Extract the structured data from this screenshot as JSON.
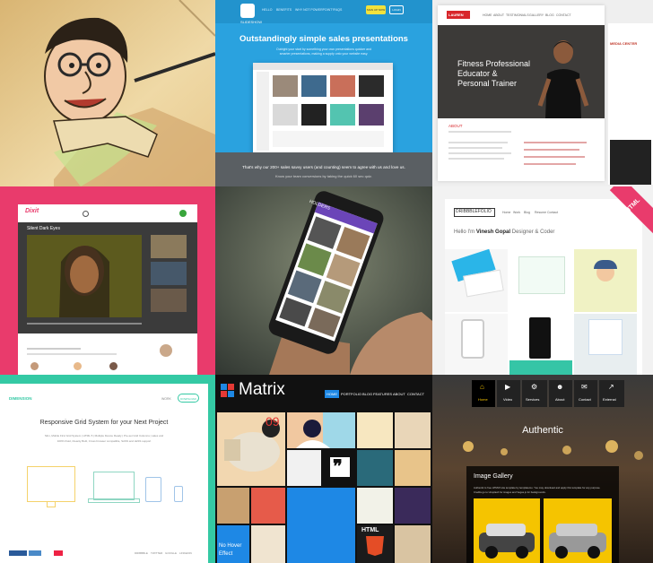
{
  "tile2": {
    "nav": [
      "HELLO",
      "BENEFITS",
      "WHY NOT POWERPOINT?",
      "FAQS"
    ],
    "cta": "SIGN UP NOW",
    "login": "LOGIN",
    "brand": "SLIDESHOW",
    "headline": "Outstandingly simple sales presentations",
    "sub1": "Outright your start by something your own presentations quicker and",
    "sub2": "smarter presentations, making a supply onto your website easy.",
    "bottom": "That's why our 200+ sales savvy users (and counting) seem to agree with us and love us.",
    "bottom2": "Know your team conversions by taking the quick 60 sec quiz."
  },
  "tile3": {
    "logo": "LAUREN",
    "nav": [
      "HOME",
      "ABOUT",
      "TESTIMONIALS",
      "GALLERY",
      "BLOG",
      "CONTACT"
    ],
    "hero": [
      "Fitness Professional",
      "Educator &",
      "Personal Trainer"
    ],
    "about": "ABOUT",
    "sideLogo": "MEDIA CENTER"
  },
  "tile4": {
    "logo": "Dixit",
    "title": "Silent Dark Eyes"
  },
  "tile5": {
    "app": "HOLDERS"
  },
  "tile6": {
    "logo": "DRIBBBLEFOLIO",
    "nav": [
      "Home",
      "Work",
      "Blog",
      "Resume",
      "Contact"
    ],
    "hello": "Hello I'm ",
    "name": "Vinesh Gopal",
    "role": " Designer & Coder",
    "ribbon": "HTML"
  },
  "tile7": {
    "logo": "DIMENSION",
    "nav": [
      "WORK"
    ],
    "cta": "DOWNLOAD",
    "title": "Responsive Grid System for your Next Project",
    "desc": [
      "Slim, Mobile First Grid System | HTML 5 | Multiple Device Ready | Pre-set Grid Columns | sales and",
      "100% Fluid, Cleanly Built, Cross browser compatible, SASS and LESS support"
    ],
    "footer": [
      "DRIBBBLE",
      "TWITTER",
      "GOOGLE",
      "LINKEDIN"
    ]
  },
  "tile8": {
    "brand": "Matrix",
    "nav": [
      "HOME",
      "PORTFOLIO",
      "BLOG",
      "FEATURES",
      "ABOUT",
      "CONTACT"
    ],
    "hover": [
      "No Hover",
      "Effect"
    ],
    "html": "HTML",
    "nine": "09"
  },
  "tile9": {
    "nav": [
      "Home",
      "Video",
      "Services",
      "About",
      "Contact",
      "External"
    ],
    "hero": "Authentic",
    "galleryTitle": "Image Gallery",
    "galleryText1": "Authentic is free HTML5 site template by templatemo. You may download and apply this template for any purpose.",
    "galleryText2": "Credits go to Unsplash for images and Vegas.js for backgrounds."
  },
  "colors": {
    "pink": "#e93b6c",
    "blue": "#2aa2df",
    "teal": "#34c9a4",
    "matrixBlue": "#1e88e5",
    "gold": "#f5c400"
  }
}
